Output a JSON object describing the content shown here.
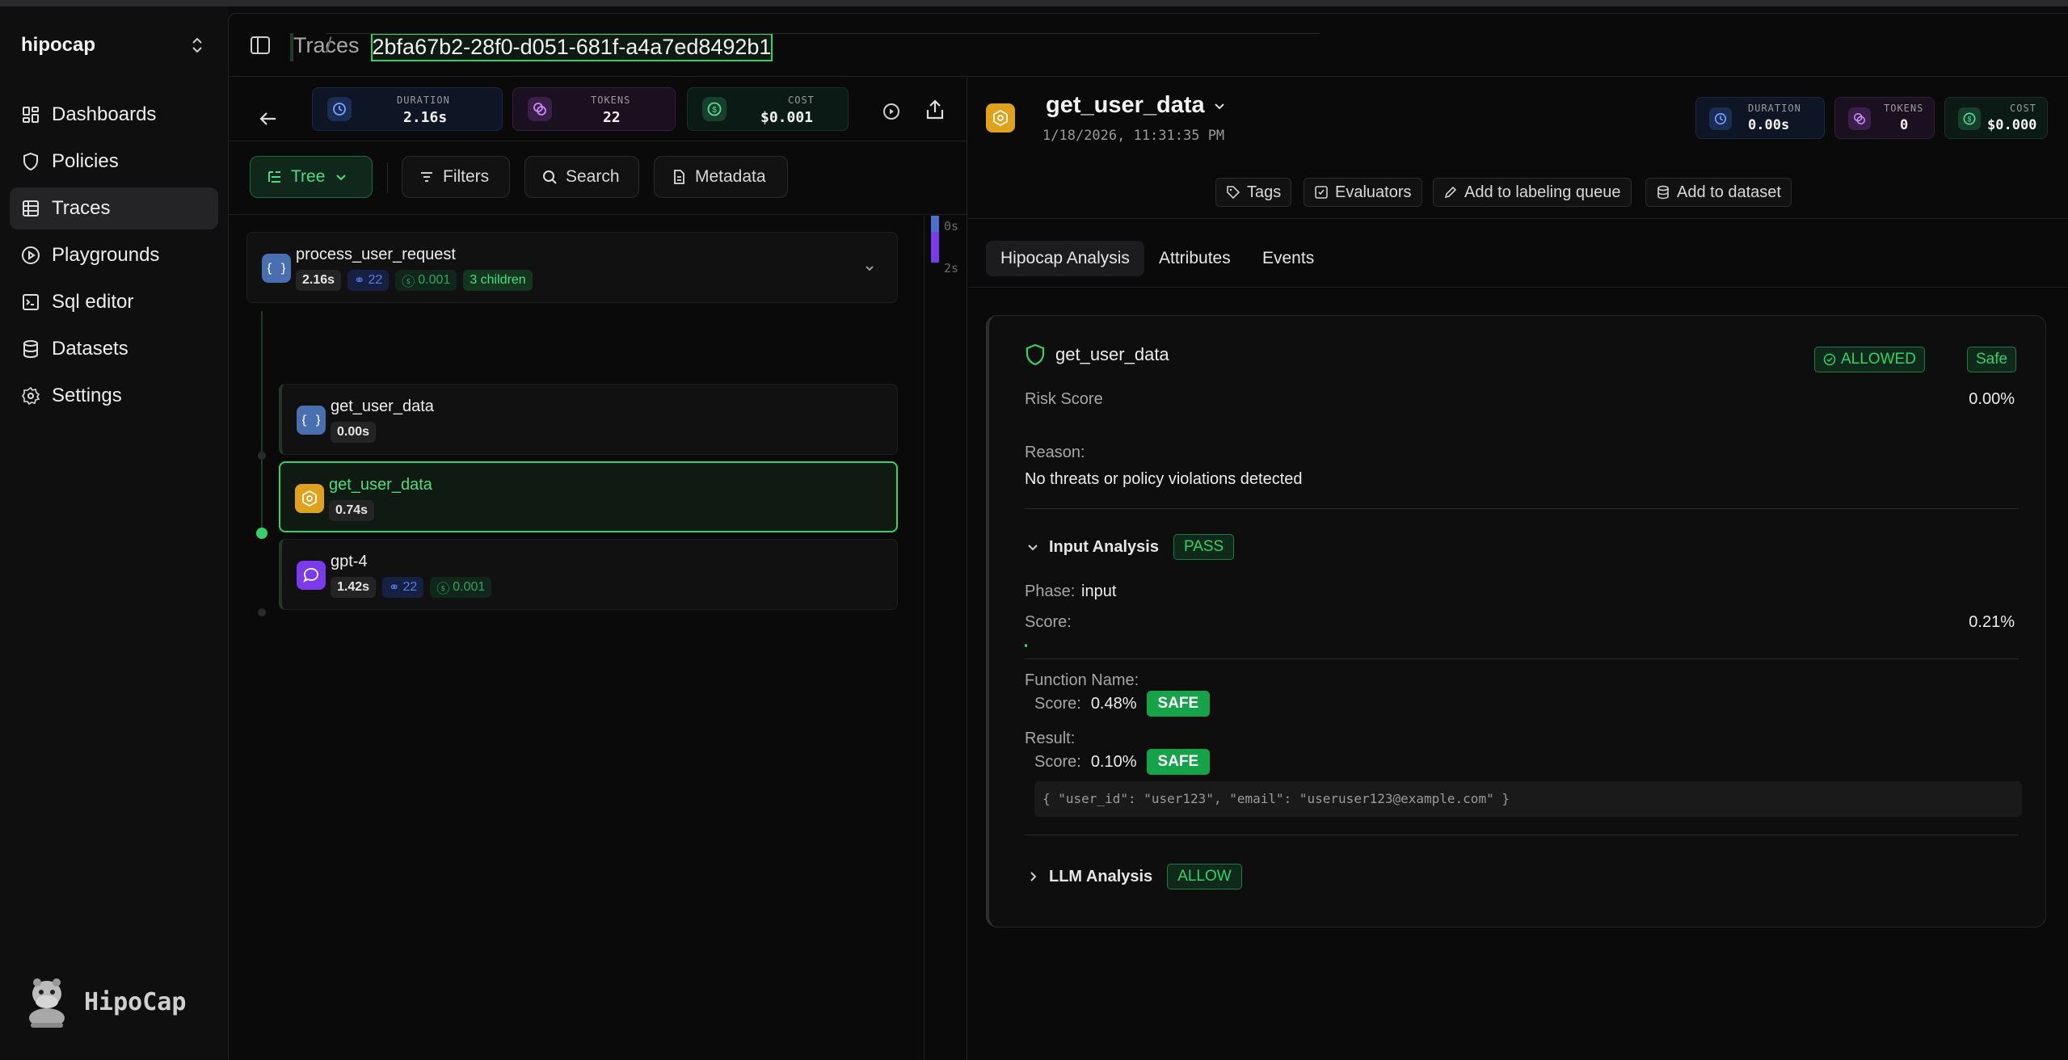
{
  "sidebar": {
    "workspace": "hipocap",
    "items": [
      {
        "label": "Dashboards",
        "icon": "dashboard-icon"
      },
      {
        "label": "Policies",
        "icon": "shield-icon"
      },
      {
        "label": "Traces",
        "icon": "list-icon",
        "active": true
      },
      {
        "label": "Playgrounds",
        "icon": "play-icon"
      },
      {
        "label": "Sql editor",
        "icon": "terminal-icon"
      },
      {
        "label": "Datasets",
        "icon": "database-icon"
      },
      {
        "label": "Settings",
        "icon": "gear-icon"
      }
    ],
    "brand": "HipoCap"
  },
  "header": {
    "section": "Traces",
    "separator": "/",
    "trace_id": "2bfa67b2-28f0-d051-681f-a4a7ed8492b1"
  },
  "trace_stats": {
    "duration_label": "DURATION",
    "duration": "2.16s",
    "tokens_label": "TOKENS",
    "tokens": "22",
    "cost_label": "COST",
    "cost": "$0.001"
  },
  "toolbar": {
    "tree": "Tree",
    "filters": "Filters",
    "search": "Search",
    "metadata": "Metadata"
  },
  "timeline": {
    "start": "0s",
    "end": "2s"
  },
  "spans": {
    "root": {
      "name": "process_user_request",
      "duration": "2.16s",
      "tokens": "22",
      "cost": "0.001",
      "children": "3 children"
    },
    "child1": {
      "name": "get_user_data",
      "duration": "0.00s"
    },
    "child2": {
      "name": "get_user_data",
      "duration": "0.74s"
    },
    "child3": {
      "name": "gpt-4",
      "duration": "1.42s",
      "tokens": "22",
      "cost": "0.001"
    }
  },
  "detail": {
    "title": "get_user_data",
    "timestamp": "1/18/2026, 11:31:35 PM",
    "duration_label": "DURATION",
    "duration": "0.00s",
    "tokens_label": "TOKENS",
    "tokens": "0",
    "cost_label": "COST",
    "cost": "$0.000",
    "actions": [
      "Tags",
      "Evaluators",
      "Add to labeling queue",
      "Add to dataset"
    ],
    "tabs": [
      "Hipocap Analysis",
      "Attributes",
      "Events"
    ]
  },
  "analysis": {
    "function": "get_user_data",
    "status": "ALLOWED",
    "safety": "Safe",
    "risk_label": "Risk Score",
    "risk_value": "0.00%",
    "reason_label": "Reason:",
    "reason": "No threats or policy violations detected",
    "input": {
      "title": "Input Analysis",
      "badge": "PASS",
      "phase_label": "Phase:",
      "phase": "input",
      "score_label": "Score:",
      "score": "0.21%",
      "score_fraction": 0.0021,
      "fn_label": "Function Name:",
      "fn_score_label": "Score:",
      "fn_score": "0.48%",
      "fn_badge": "SAFE",
      "result_label": "Result:",
      "result_score_label": "Score:",
      "result_score": "0.10%",
      "result_badge": "SAFE",
      "result_json": "{ \"user_id\": \"user123\", \"email\": \"useruser123@example.com\" }"
    },
    "llm": {
      "title": "LLM Analysis",
      "badge": "ALLOW"
    }
  }
}
